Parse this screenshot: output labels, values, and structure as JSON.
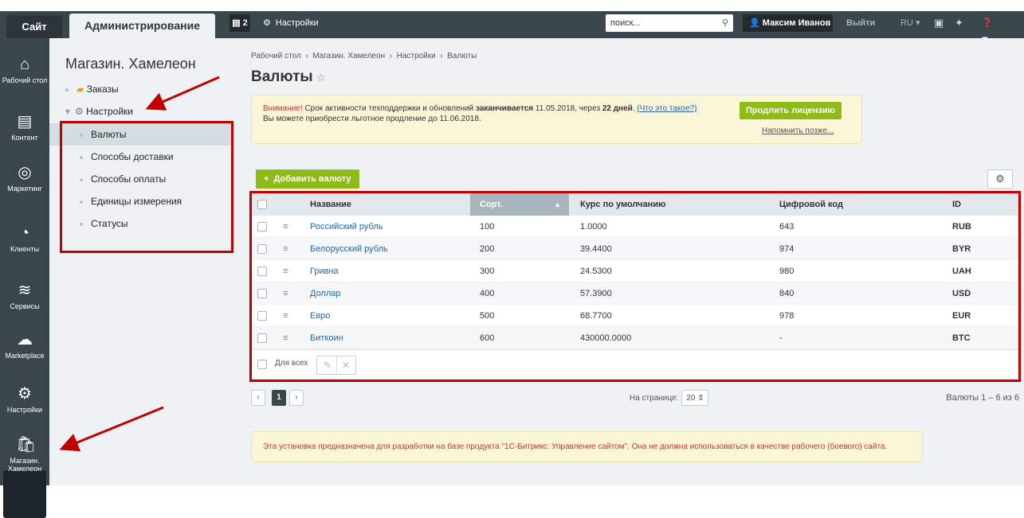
{
  "topbar": {
    "site_tab": "Сайт",
    "admin_tab": "Администрирование",
    "notifications_count": "2",
    "settings_label": "Настройки",
    "search_placeholder": "поиск...",
    "user_name": "Максим Иванов",
    "logout_label": "Выйти",
    "lang_label": "RU",
    "help_label": "Помощь"
  },
  "leftnav": {
    "items": [
      {
        "label": "Рабочий стол",
        "icon": "home-icon"
      },
      {
        "label": "Контент",
        "icon": "document-icon"
      },
      {
        "label": "Маркетинг",
        "icon": "target-icon"
      },
      {
        "label": "Клиенты",
        "icon": "clock-24-icon"
      },
      {
        "label": "Сервисы",
        "icon": "layers-icon"
      },
      {
        "label": "Marketplace",
        "icon": "cloud-download-icon"
      },
      {
        "label": "Настройки",
        "icon": "gear-icon"
      },
      {
        "label": "Магазин. Хамелеон",
        "icon": "shopping-bag-icon"
      }
    ]
  },
  "sidebar": {
    "title": "Магазин. Хамелеон",
    "orders": "Заказы",
    "settings": "Настройки",
    "children": [
      "Валюты",
      "Способы доставки",
      "Способы оплаты",
      "Единицы измерения",
      "Статусы"
    ]
  },
  "main": {
    "breadcrumb": [
      "Рабочий стол",
      "Магазин. Хамелеон",
      "Настройки",
      "Валюты"
    ],
    "title": "Валюты",
    "warning": {
      "prefix": "Внимание!",
      "text1": " Срок активности техподдержки и обновлений ",
      "bold1": "заканчивается",
      "text2": " 11.05.2018, через ",
      "bold2": "22 дней",
      "text3": ". ",
      "link": "(Что это такое?)",
      "line2": "Вы можете приобрести льготное продление до 11.06.2018.",
      "button": "Продлить лицензию",
      "remind": "Напомнить позже..."
    },
    "add_button": "Добавить валюту",
    "table": {
      "headers": {
        "name": "Название",
        "sort": "Сорт.",
        "rate": "Курс по умолчанию",
        "code": "Цифровой код",
        "id": "ID"
      },
      "rows": [
        {
          "name": "Российский рубль",
          "sort": "100",
          "rate": "1.0000",
          "code": "643",
          "id": "RUB"
        },
        {
          "name": "Белорусский рубль",
          "sort": "200",
          "rate": "39.4400",
          "code": "974",
          "id": "BYR"
        },
        {
          "name": "Гривна",
          "sort": "300",
          "rate": "24.5300",
          "code": "980",
          "id": "UAH"
        },
        {
          "name": "Доллар",
          "sort": "400",
          "rate": "57.3900",
          "code": "840",
          "id": "USD"
        },
        {
          "name": "Евро",
          "sort": "500",
          "rate": "68.7700",
          "code": "978",
          "id": "EUR"
        },
        {
          "name": "Биткоин",
          "sort": "600",
          "rate": "430000.0000",
          "code": "-",
          "id": "BTC"
        }
      ],
      "for_all": "Для всех"
    },
    "pager": {
      "page": "1",
      "per_page_label": "На странице:",
      "per_page": "20",
      "count": "Валюты 1 – 6 из 6"
    },
    "dev_warning": "Эта установка предназначена для разработки на базе продукта \"1С-Битрикс: Управление сайтом\". Она не должна использоваться в качестве рабочего (боевого) сайта."
  }
}
